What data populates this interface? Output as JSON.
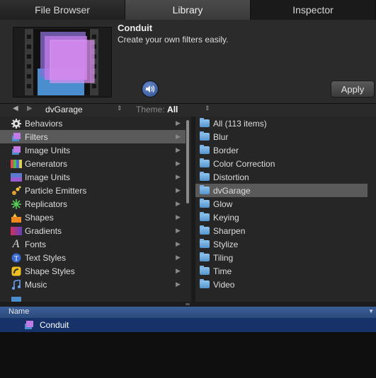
{
  "tabs": [
    "File Browser",
    "Library",
    "Inspector"
  ],
  "preview": {
    "name": "Conduit",
    "description": "Create your own filters easily.",
    "apply_label": "Apply"
  },
  "toolbar": {
    "source": "dvGarage",
    "theme_label": "Theme:",
    "theme_value": "All"
  },
  "categories": [
    {
      "label": "Behaviors",
      "icon": "gear-icon"
    },
    {
      "label": "Filters",
      "icon": "filters-icon",
      "selected": true
    },
    {
      "label": "Image Units",
      "icon": "image-units-icon"
    },
    {
      "label": "Generators",
      "icon": "generators-icon"
    },
    {
      "label": "Image Units",
      "icon": "image-units-icon"
    },
    {
      "label": "Particle Emitters",
      "icon": "particle-emitters-icon"
    },
    {
      "label": "Replicators",
      "icon": "replicators-icon"
    },
    {
      "label": "Shapes",
      "icon": "shapes-icon"
    },
    {
      "label": "Gradients",
      "icon": "gradients-icon"
    },
    {
      "label": "Fonts",
      "icon": "fonts-icon"
    },
    {
      "label": "Text Styles",
      "icon": "text-styles-icon"
    },
    {
      "label": "Shape Styles",
      "icon": "shape-styles-icon"
    },
    {
      "label": "Music",
      "icon": "music-icon"
    }
  ],
  "folders": [
    {
      "label": "All (113 items)"
    },
    {
      "label": "Blur"
    },
    {
      "label": "Border"
    },
    {
      "label": "Color Correction"
    },
    {
      "label": "Distortion"
    },
    {
      "label": "dvGarage",
      "selected": true
    },
    {
      "label": "Glow"
    },
    {
      "label": "Keying"
    },
    {
      "label": "Sharpen"
    },
    {
      "label": "Stylize"
    },
    {
      "label": "Tiling"
    },
    {
      "label": "Time"
    },
    {
      "label": "Video"
    }
  ],
  "list": {
    "header": "Name",
    "items": [
      {
        "label": "Conduit"
      }
    ]
  },
  "colors": {
    "header_blue": "#2b4a7c",
    "selected_row": "#163268",
    "folder_blue": "#6ba8df",
    "selection_gray": "#5a5a5a"
  }
}
